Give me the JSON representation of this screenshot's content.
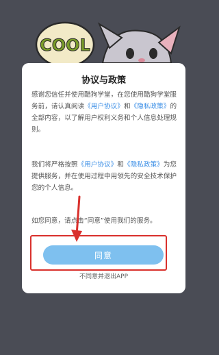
{
  "dialog": {
    "title": "协议与政策",
    "p1": {
      "a": "感谢您信任并使用酷狗学堂，在您使用酷狗学堂服务前，请认真阅读",
      "link1": "《用户协议》",
      "b": "和",
      "link2": "《隐私政策》",
      "c": "的全部内容，以了解用户权利义务和个人信息处理规则。"
    },
    "p2": {
      "a": "我们将严格按照",
      "link1": "《用户协议》",
      "b": "和",
      "link2": "《隐私政策》",
      "c": "为您提供服务，并在使用过程中用领先的安全技术保护您的个人信息。"
    },
    "p3": "如您同意，请点击“同意”使用我们的服务。",
    "agree_label": "同意",
    "decline_label": "不同意并退出APP"
  },
  "backdrop": {
    "logo_text": "COOL"
  },
  "colors": {
    "backdrop": "#4a4c55",
    "button": "#7ec0ef",
    "link": "#3a8ee6",
    "highlight": "#d9302c"
  }
}
